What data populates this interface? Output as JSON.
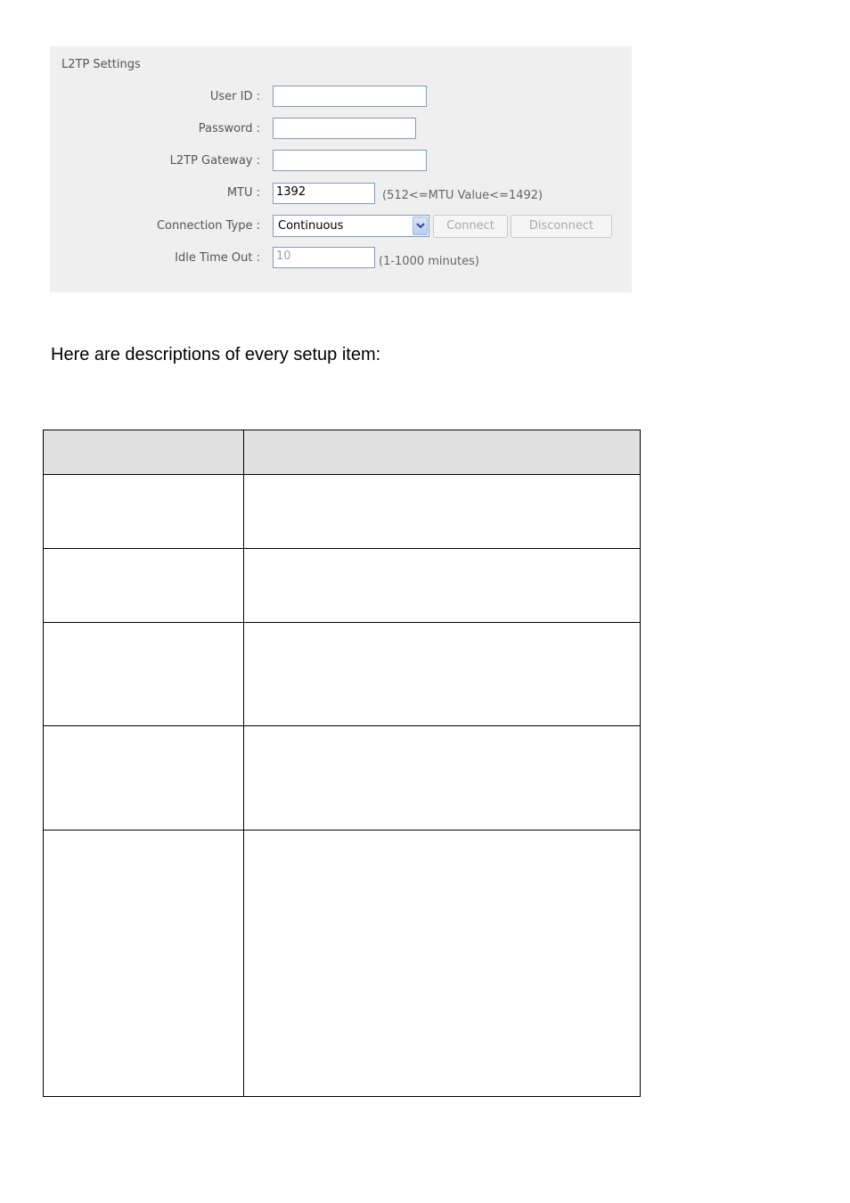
{
  "l2tp": {
    "title": "L2TP Settings",
    "user_id_label": "User ID :",
    "user_id_value": "",
    "password_label": "Password :",
    "password_value": "",
    "gateway_label": "L2TP Gateway :",
    "gateway_value": "",
    "mtu_label": "MTU :",
    "mtu_value": "1392",
    "mtu_hint": "(512<=MTU Value<=1492)",
    "connection_type_label": "Connection Type :",
    "connection_type_value": "Continuous",
    "connect_label": "Connect",
    "disconnect_label": "Disconnect",
    "idle_label": "Idle Time Out :",
    "idle_value": "10",
    "idle_hint": "(1-1000 minutes)"
  },
  "description_text": "Here are descriptions of every setup item:",
  "table": {
    "header": [
      "",
      ""
    ],
    "rows": [
      [
        "",
        ""
      ],
      [
        "",
        ""
      ],
      [
        "",
        ""
      ],
      [
        "",
        ""
      ],
      [
        "",
        ""
      ]
    ]
  }
}
